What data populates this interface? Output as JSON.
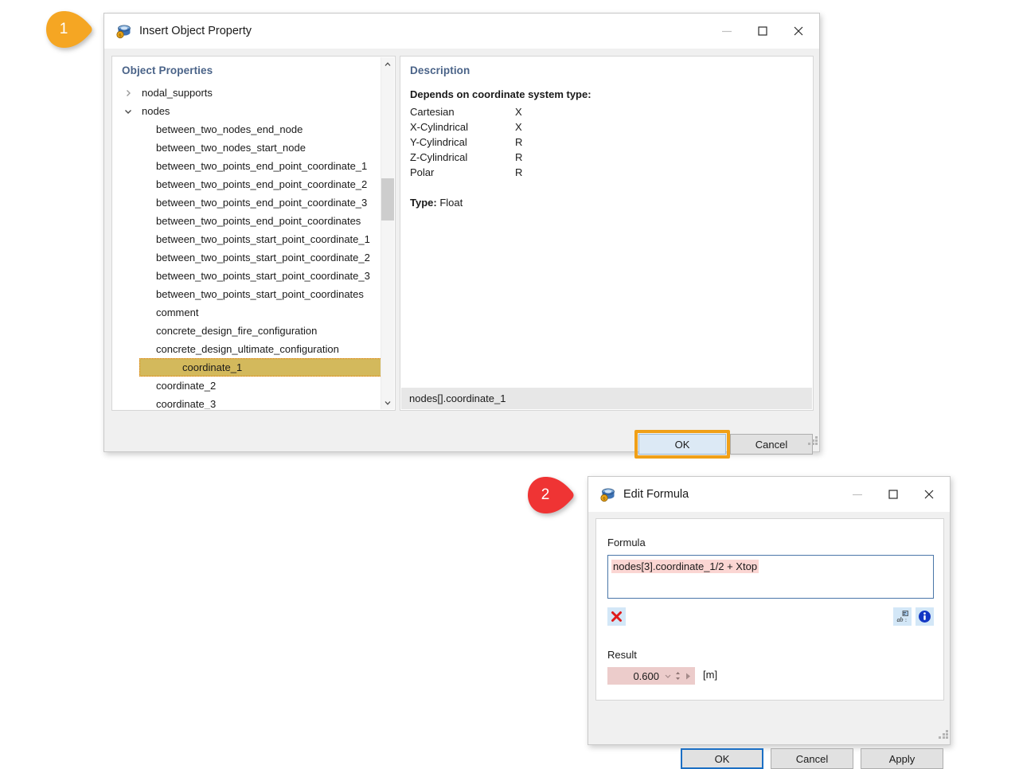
{
  "callouts": [
    {
      "number": "1",
      "color": "#f5a623"
    },
    {
      "number": "2",
      "color": "#ef3434"
    }
  ],
  "insert_dialog": {
    "title": "Insert Object Property",
    "app_icon": "database-cylinder-icon",
    "window_controls": {
      "minimize": "minimize-icon",
      "maximize": "maximize-icon",
      "close": "close-icon"
    },
    "properties_panel": {
      "title": "Object Properties",
      "items": [
        {
          "label": "nodal_supports",
          "level": "group",
          "expanded": false
        },
        {
          "label": "nodes",
          "level": "group",
          "expanded": true
        },
        {
          "label": "between_two_nodes_end_node",
          "level": "child"
        },
        {
          "label": "between_two_nodes_start_node",
          "level": "child"
        },
        {
          "label": "between_two_points_end_point_coordinate_1",
          "level": "child"
        },
        {
          "label": "between_two_points_end_point_coordinate_2",
          "level": "child"
        },
        {
          "label": "between_two_points_end_point_coordinate_3",
          "level": "child"
        },
        {
          "label": "between_two_points_end_point_coordinates",
          "level": "child"
        },
        {
          "label": "between_two_points_start_point_coordinate_1",
          "level": "child"
        },
        {
          "label": "between_two_points_start_point_coordinate_2",
          "level": "child"
        },
        {
          "label": "between_two_points_start_point_coordinate_3",
          "level": "child"
        },
        {
          "label": "between_two_points_start_point_coordinates",
          "level": "child"
        },
        {
          "label": "comment",
          "level": "child"
        },
        {
          "label": "concrete_design_fire_configuration",
          "level": "child"
        },
        {
          "label": "concrete_design_ultimate_configuration",
          "level": "child"
        },
        {
          "label": "coordinate_1",
          "level": "child",
          "selected": true
        },
        {
          "label": "coordinate_2",
          "level": "child"
        },
        {
          "label": "coordinate_3",
          "level": "child"
        }
      ],
      "selection_bg": "#d3b95c",
      "selection_border": "#e07b00"
    },
    "description_panel": {
      "title": "Description",
      "heading": "Depends on coordinate system type:",
      "rows": [
        {
          "system": "Cartesian",
          "value": "X"
        },
        {
          "system": "X-Cylindrical",
          "value": "X"
        },
        {
          "system": "Y-Cylindrical",
          "value": "R"
        },
        {
          "system": "Z-Cylindrical",
          "value": "R"
        },
        {
          "system": "Polar",
          "value": "R"
        }
      ],
      "type_label": "Type:",
      "type_value": "Float",
      "path": "nodes[].coordinate_1"
    },
    "buttons": {
      "ok": "OK",
      "cancel": "Cancel",
      "ok_highlight_color": "#f0a018"
    }
  },
  "formula_dialog": {
    "title": "Edit Formula",
    "app_icon": "database-cylinder-icon",
    "window_controls": {
      "minimize": "minimize-icon",
      "maximize": "maximize-icon",
      "close": "close-icon"
    },
    "formula_label": "Formula",
    "formula_value": "nodes[3].coordinate_1/2 + Xtop",
    "formula_highlight_color": "#fbd6d3",
    "toolbar": {
      "clear": "red-x-icon",
      "text_format": "text-format-icon",
      "info": "info-icon"
    },
    "result_label": "Result",
    "result_value": "0.600",
    "result_unit": "[m]",
    "result_bg": "#eccccb",
    "buttons": {
      "ok": "OK",
      "cancel": "Cancel",
      "apply": "Apply",
      "ok_focus_color": "#1b6fc4"
    }
  }
}
